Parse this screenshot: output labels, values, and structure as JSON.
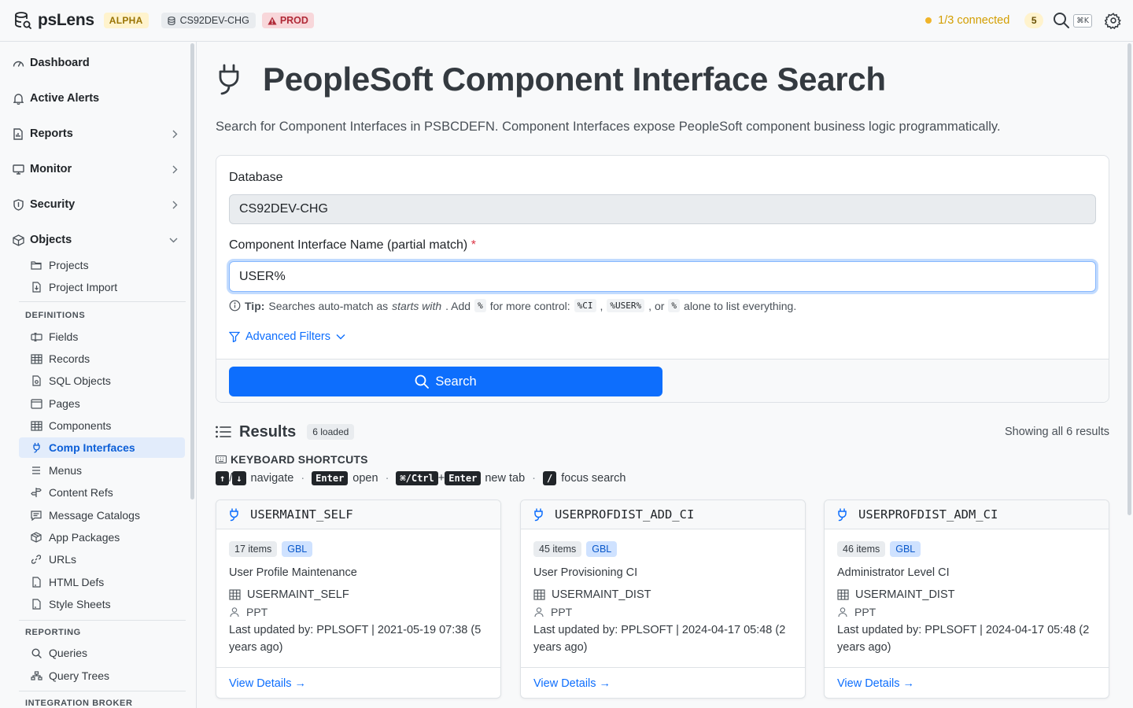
{
  "topbar": {
    "brand": "psLens",
    "alpha_badge": "ALPHA",
    "database": "CS92DEV-CHG",
    "env_badge": "PROD",
    "connection_status": "1/3 connected",
    "alert_count": "5",
    "shortcut_hint": "⌘K"
  },
  "sidebar": {
    "top": [
      {
        "label": "Dashboard",
        "icon": "gauge-icon"
      },
      {
        "label": "Active Alerts",
        "icon": "bell-icon"
      },
      {
        "label": "Reports",
        "icon": "report-icon"
      },
      {
        "label": "Monitor",
        "icon": "monitor-icon"
      },
      {
        "label": "Security",
        "icon": "shield-icon"
      },
      {
        "label": "Objects",
        "icon": "box-icon"
      }
    ],
    "objects_items": [
      {
        "label": "Projects",
        "icon": "folder-icon"
      },
      {
        "label": "Project Import",
        "icon": "file-import-icon"
      }
    ],
    "definitions_header": "DEFINITIONS",
    "definitions_items": [
      {
        "label": "Fields",
        "icon": "field-icon"
      },
      {
        "label": "Records",
        "icon": "table-icon"
      },
      {
        "label": "SQL Objects",
        "icon": "file-code-icon"
      },
      {
        "label": "Pages",
        "icon": "window-icon"
      },
      {
        "label": "Components",
        "icon": "grid-icon"
      },
      {
        "label": "Comp Interfaces",
        "icon": "plug-icon"
      },
      {
        "label": "Menus",
        "icon": "menu-icon"
      },
      {
        "label": "Content Refs",
        "icon": "signpost-icon"
      },
      {
        "label": "Message Catalogs",
        "icon": "message-icon"
      },
      {
        "label": "App Packages",
        "icon": "package-icon"
      },
      {
        "label": "URLs",
        "icon": "link-icon"
      },
      {
        "label": "HTML Defs",
        "icon": "file-html-icon"
      },
      {
        "label": "Style Sheets",
        "icon": "file-style-icon"
      }
    ],
    "reporting_header": "REPORTING",
    "reporting_items": [
      {
        "label": "Queries",
        "icon": "search-icon"
      },
      {
        "label": "Query Trees",
        "icon": "tree-icon"
      }
    ],
    "integration_header": "INTEGRATION BROKER"
  },
  "main": {
    "title": "PeopleSoft Component Interface Search",
    "description": "Search for Component Interfaces in PSBCDEFN. Component Interfaces expose PeopleSoft component business logic programmatically.",
    "form": {
      "db_label": "Database",
      "db_value": "CS92DEV-CHG",
      "ci_label": "Component Interface Name (partial match)",
      "required_mark": "*",
      "ci_value": "USER%",
      "tip_bold": "Tip:",
      "tip_1": "Searches auto-match as",
      "tip_em": "starts with",
      "tip_2": ". Add",
      "tip_code_1": "%",
      "tip_3": "for more control:",
      "tip_code_2": "%CI",
      "tip_comma": ",",
      "tip_code_3": "%USER%",
      "tip_4": ", or",
      "tip_code_4": "%",
      "tip_5": "alone to list everything.",
      "advanced": "Advanced Filters",
      "search_button": "Search"
    },
    "results": {
      "title": "Results",
      "loaded_badge": "6 loaded",
      "showing": "Showing all 6 results"
    },
    "shortcuts": {
      "header": "KEYBOARD SHORTCUTS",
      "up": "↑",
      "slash": "/",
      "down": "↓",
      "navigate": "navigate",
      "dot": "·",
      "enter": "Enter",
      "open": "open",
      "cmd_ctrl": "⌘/Ctrl",
      "plus": "+",
      "new_tab": "new tab",
      "slash_key": "/",
      "focus_search": "focus search"
    },
    "cards": [
      {
        "name": "USERMAINT_SELF",
        "items": "17 items",
        "scope": "GBL",
        "description": "User Profile Maintenance",
        "record": "USERMAINT_SELF",
        "owner": "PPT",
        "updated": "Last updated by:  PPLSOFT   |   2021-05-19 07:38 (5 years ago)",
        "link": "View Details →"
      },
      {
        "name": "USERPROFDIST_ADD_CI",
        "items": "45 items",
        "scope": "GBL",
        "description": "User Provisioning CI",
        "record": "USERMAINT_DIST",
        "owner": "PPT",
        "updated": "Last updated by:  PPLSOFT   |   2024-04-17 05:48 (2 years ago)",
        "link": "View Details →"
      },
      {
        "name": "USERPROFDIST_ADM_CI",
        "items": "46 items",
        "scope": "GBL",
        "description": "Administrator Level CI",
        "record": "USERMAINT_DIST",
        "owner": "PPT",
        "updated": "Last updated by:  PPLSOFT   |   2024-04-17 05:48 (2 years ago)",
        "link": "View Details →"
      }
    ]
  },
  "colors": {
    "primary": "#0d6efd",
    "active_nav_bg": "#e2ecfb",
    "warning": "#f0b429",
    "danger": "#dc3545"
  }
}
